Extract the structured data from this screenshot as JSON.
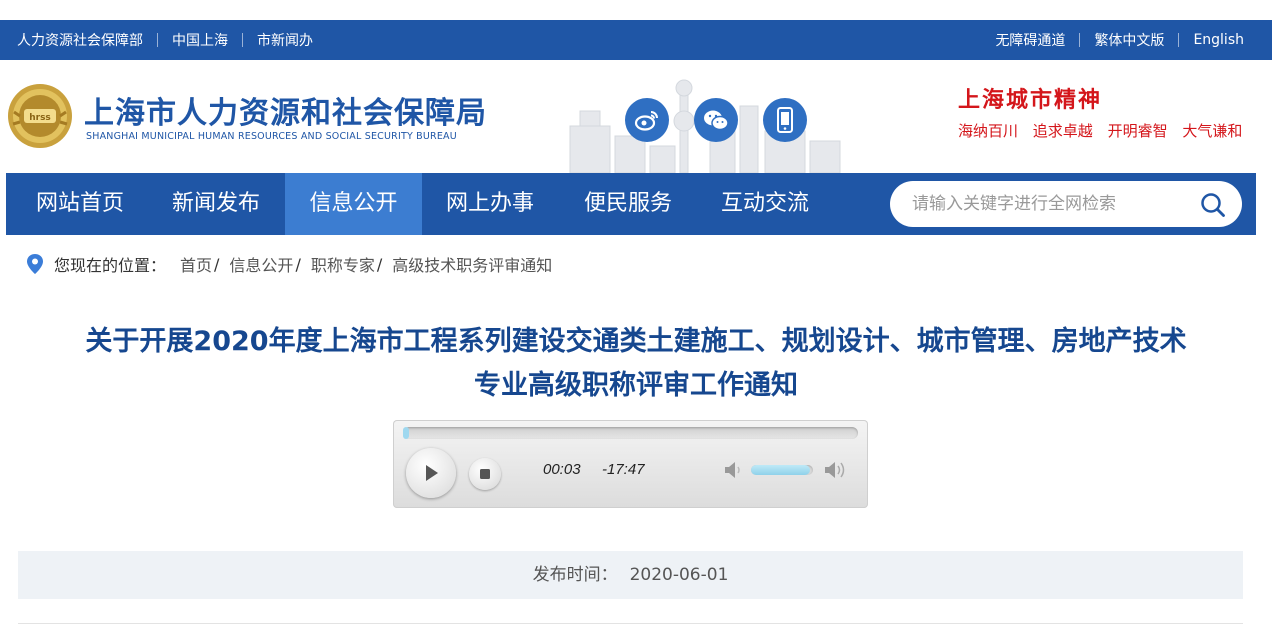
{
  "topbar": {
    "left_links": [
      "人力资源社会保障部",
      "中国上海",
      "市新闻办"
    ],
    "right_links": [
      "无障碍通道",
      "繁体中文版",
      "English"
    ]
  },
  "header": {
    "title": "上海市人力资源和社会保障局",
    "subtitle": "SHANGHAI MUNICIPAL HUMAN RESOURCES AND SOCIAL SECURITY BUREAU",
    "emblem_text": "hrss",
    "social_icons": [
      "weibo-icon",
      "wechat-icon",
      "mobile-icon"
    ],
    "slogan_title": "上海城市精神",
    "slogan_words": [
      "海纳百川",
      "追求卓越",
      "开明睿智",
      "大气谦和"
    ]
  },
  "nav": {
    "items": [
      "网站首页",
      "新闻发布",
      "信息公开",
      "网上办事",
      "便民服务",
      "互动交流"
    ],
    "active": "信息公开",
    "search_placeholder": "请输入关键字进行全网检索"
  },
  "breadcrumb": {
    "label": "您现在的位置：",
    "items": [
      "首页",
      "信息公开",
      "职称专家"
    ],
    "current": "高级技术职务评审通知"
  },
  "article": {
    "title_line1": "关于开展2020年度上海市工程系列建设交通类土建施工、规划设计、城市管理、房地产技术",
    "title_line2": "专业高级职称评审工作通知"
  },
  "player": {
    "elapsed": "00:03",
    "remaining": "-17:47",
    "progress_fraction": 0.003,
    "volume_fraction": 0.95
  },
  "meta": {
    "publish_label": "发布时间：",
    "publish_date": "2020-06-01"
  },
  "colors": {
    "primary_blue": "#1f56a6",
    "active_nav": "#3c7dd1",
    "title_blue": "#16478f",
    "slogan_red": "#d4161b"
  }
}
